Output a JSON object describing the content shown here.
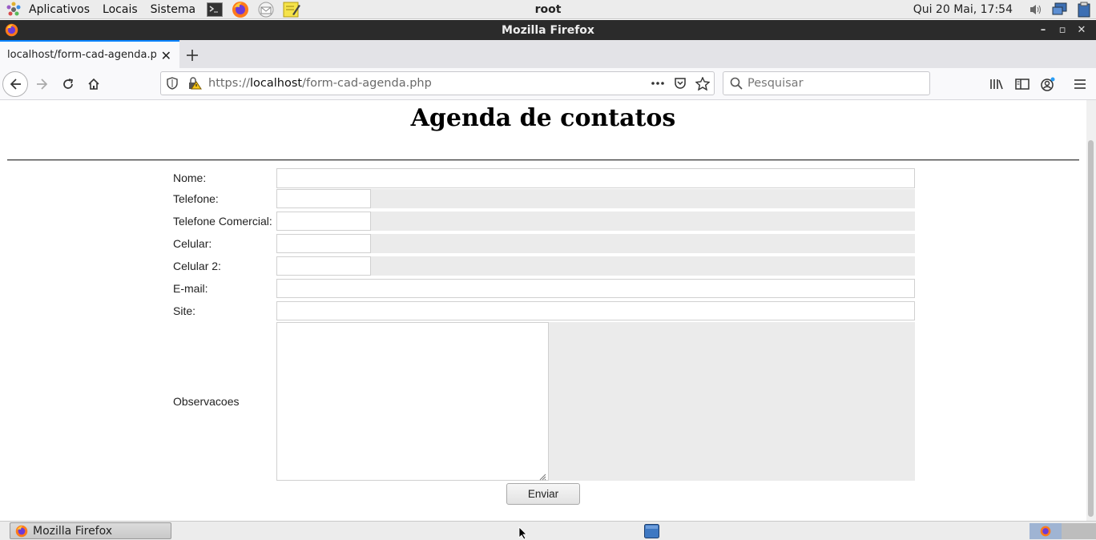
{
  "top_panel": {
    "menus": [
      "Aplicativos",
      "Locais",
      "Sistema"
    ],
    "user": "root",
    "clock": "Qui 20 Mai, 17:54",
    "launchers": [
      "terminal-icon",
      "firefox-icon",
      "mail-icon",
      "text-editor-icon"
    ]
  },
  "window": {
    "title": "Mozilla Firefox"
  },
  "tabs": [
    {
      "title": "localhost/form-cad-agenda.p",
      "active": true
    }
  ],
  "navbar": {
    "url_scheme": "https://",
    "url_host": "localhost",
    "url_path": "/form-cad-agenda.php",
    "search_placeholder": "Pesquisar"
  },
  "page": {
    "title": "Agenda de contatos",
    "fields": [
      {
        "label": "Nome:",
        "type": "text",
        "value": ""
      },
      {
        "label": "Telefone:",
        "type": "short",
        "value": ""
      },
      {
        "label": "Telefone Comercial:",
        "type": "short",
        "value": ""
      },
      {
        "label": "Celular:",
        "type": "short",
        "value": ""
      },
      {
        "label": "Celular 2:",
        "type": "short",
        "value": ""
      },
      {
        "label": "E-mail:",
        "type": "text",
        "value": ""
      },
      {
        "label": "Site:",
        "type": "text",
        "value": ""
      },
      {
        "label": "Observacoes",
        "type": "textarea",
        "value": ""
      }
    ],
    "submit_label": "Enviar"
  },
  "taskbar": {
    "window_button": "Mozilla Firefox"
  },
  "colors": {
    "tab_accent": "#0a84ff",
    "titlebar": "#2b2b2b",
    "field_cell_bg": "#ebebeb"
  }
}
